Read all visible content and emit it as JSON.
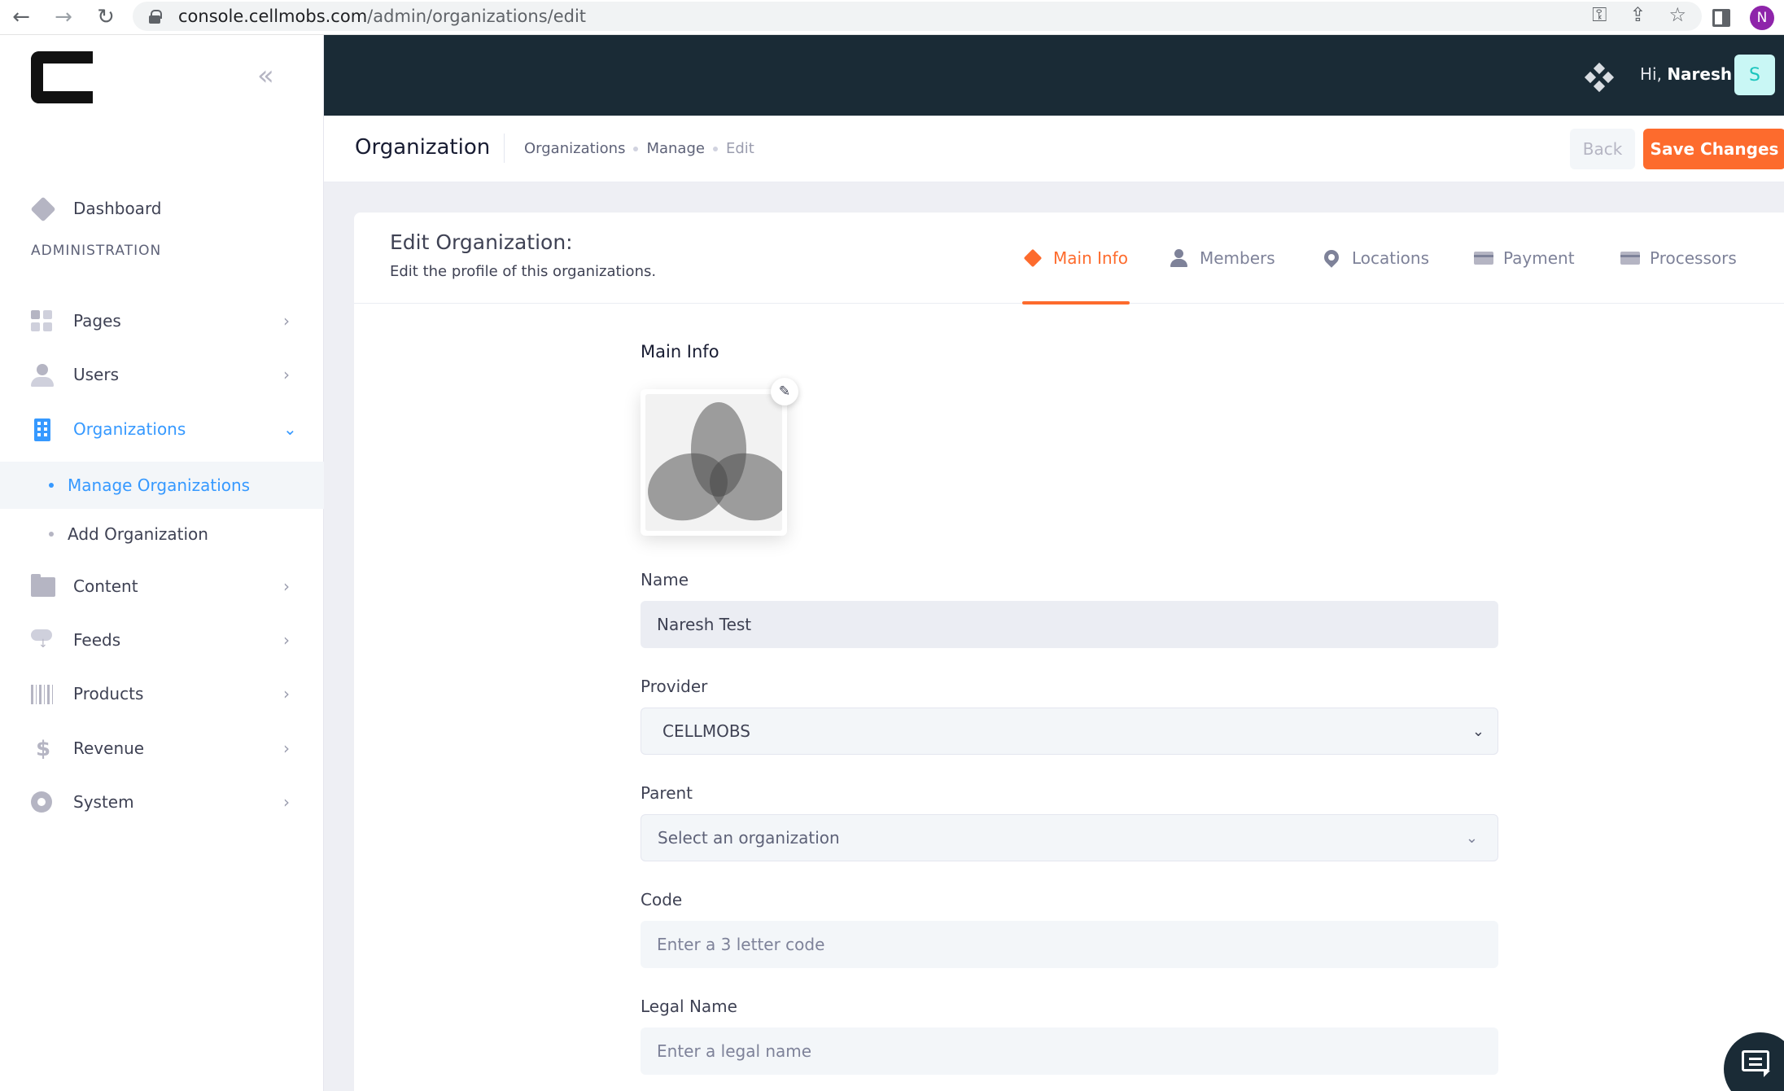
{
  "browser": {
    "url_domain": "console.cellmobs.com",
    "url_path": "/admin/organizations/edit",
    "profile_initial": "N"
  },
  "sidebar": {
    "section_title": "ADMINISTRATION",
    "dashboard": "Dashboard",
    "items": [
      {
        "label": "Pages",
        "icon": "pages-icon"
      },
      {
        "label": "Users",
        "icon": "users-icon"
      },
      {
        "label": "Organizations",
        "icon": "building-icon",
        "active": true
      },
      {
        "label": "Content",
        "icon": "folder-icon"
      },
      {
        "label": "Feeds",
        "icon": "cloud-download-icon"
      },
      {
        "label": "Products",
        "icon": "barcode-icon"
      },
      {
        "label": "Revenue",
        "icon": "dollar-icon"
      },
      {
        "label": "System",
        "icon": "gear-icon"
      }
    ],
    "sub_items": [
      "Manage Organizations",
      "Add Organization"
    ]
  },
  "topbar": {
    "greeting": "Hi,",
    "user_name": "Naresh",
    "avatar_initial": "S"
  },
  "subheader": {
    "title": "Organization",
    "breadcrumbs": [
      "Organizations",
      "Manage",
      "Edit"
    ],
    "back_label": "Back",
    "save_label": "Save Changes"
  },
  "card": {
    "title": "Edit Organization:",
    "subtitle": "Edit the profile of this organizations.",
    "tabs": [
      "Main Info",
      "Members",
      "Locations",
      "Payment",
      "Processors"
    ],
    "active_tab": "Main Info"
  },
  "form": {
    "section_heading": "Main Info",
    "name_label": "Name",
    "name_value": "Naresh Test",
    "provider_label": "Provider",
    "provider_value": "CELLMOBS",
    "parent_label": "Parent",
    "parent_placeholder": "Select an organization",
    "code_label": "Code",
    "code_placeholder": "Enter a 3 letter code",
    "legal_label": "Legal Name",
    "legal_placeholder": "Enter a legal name"
  },
  "colors": {
    "accent": "#fd6b2d",
    "primary": "#3699ff",
    "topbar_bg": "#1a2b36"
  }
}
